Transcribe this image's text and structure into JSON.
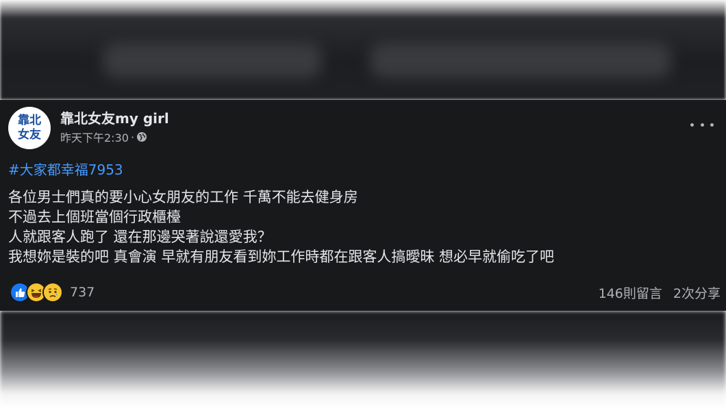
{
  "post": {
    "avatar_text": "靠北女友",
    "page_name": "靠北女友my girl",
    "timestamp": "昨天下午2:30",
    "separator": "·",
    "hashtag": "#大家都幸福7953",
    "lines": [
      "各位男士們真的要小心女朋友的工作 千萬不能去健身房",
      "不過去上個班當個行政櫃檯",
      "人就跟客人跑了 還在那邊哭著說還愛我？",
      "我想妳是裝的吧 真會演 早就有朋友看到妳工作時都在跟客人搞曖昧 想必早就偷吃了吧"
    ],
    "reactions": {
      "icons": [
        "like-icon",
        "haha-icon",
        "sad-icon"
      ],
      "count": "737"
    },
    "comments": "146則留言",
    "shares": "2次分享"
  },
  "colors": {
    "post_background": "#18191a",
    "primary_text": "#e4e6eb",
    "secondary_text": "#b0b3b8",
    "hashtag": "#4599ff",
    "avatar_text": "#1c4fa0"
  }
}
